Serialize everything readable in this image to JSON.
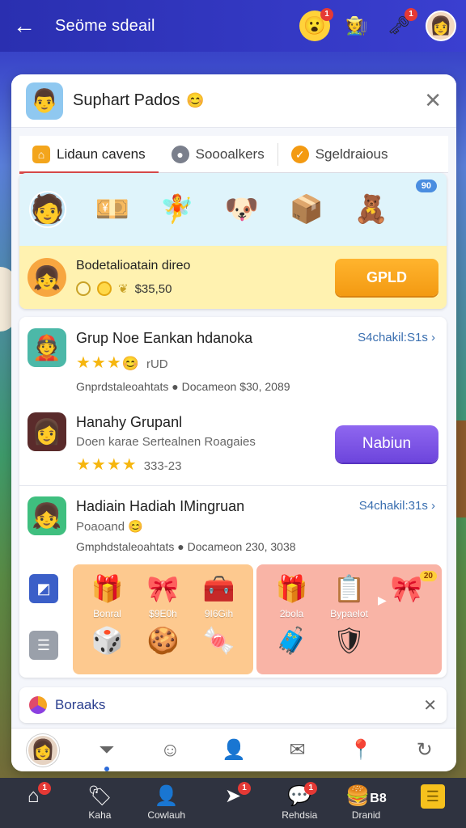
{
  "topbar": {
    "back_icon": "arrow-left-icon",
    "title": "Seöme sdeail",
    "badges": [
      "1",
      "1"
    ]
  },
  "card": {
    "user_name": "Suphart Pados",
    "close_icon": "close-icon"
  },
  "tabs": [
    {
      "label": "Lidaun cavens",
      "icon": "home-icon",
      "color": "#f3a51c"
    },
    {
      "label": "Soooalkers",
      "icon": "location-icon",
      "color": "#7a7f8c"
    },
    {
      "label": "Sgeldraious",
      "icon": "check-icon",
      "color": "#f39a12"
    }
  ],
  "featured": {
    "count_badge": "90",
    "offer_title": "Bodetalioatain direo",
    "offer_value": "$35,50",
    "button": "GPLD"
  },
  "list": {
    "row1": {
      "title": "Grup Noe Eankan hdanoka",
      "stars_extra": "rUD",
      "meta": "Gnprdstaleoahtats ● Docameon $30, 2089",
      "link": "S4chakil:S1s"
    },
    "row2": {
      "title": "Hanahy Grupanl",
      "sub": "Doen karae Sertealnen Roagaies",
      "stars_extra": "333-23",
      "button": "Nabiun"
    },
    "row3": {
      "title": "Hadiain Hadiah IMingruan",
      "sub": "Poaoand",
      "meta": "Gmphdstaleoahtats ● Docameon 230, 3038",
      "link": "S4chakil:31s"
    }
  },
  "rewards": {
    "left": [
      {
        "label": "Bonral",
        "icon": "gift-box-icon"
      },
      {
        "label": "$9E0h",
        "icon": "gift-box-icon"
      },
      {
        "label": "9I6Gih",
        "icon": "treasure-chest-icon"
      },
      {
        "label": "",
        "icon": "dice-icon"
      },
      {
        "label": "",
        "icon": "cookie-icon"
      },
      {
        "label": "",
        "icon": "candy-icon"
      }
    ],
    "right": [
      {
        "label": "2bola",
        "icon": "gift-box-icon"
      },
      {
        "label": "Bypaelot",
        "icon": "clipboard-icon"
      },
      {
        "label": "",
        "icon": "gift-icon"
      },
      {
        "label": "",
        "icon": "chest-icon"
      },
      {
        "label": "",
        "icon": "shield-icon"
      },
      {
        "label": "",
        "icon": ""
      }
    ],
    "right_badge": "20"
  },
  "strip": {
    "label": "Boraaks"
  },
  "bottomnav": [
    {
      "label": "",
      "icon": "home-icon",
      "badge": "1"
    },
    {
      "label": "Kaha",
      "icon": "tag-icon",
      "badge": ""
    },
    {
      "label": "Cowlauh",
      "icon": "person-icon",
      "badge": ""
    },
    {
      "label": "",
      "icon": "send-icon",
      "badge": "1"
    },
    {
      "label": "Rehdsia",
      "icon": "chat-icon",
      "badge": "1"
    },
    {
      "label": "Dranid",
      "icon": "food-icon",
      "badge": ""
    },
    {
      "label": "",
      "icon": "menu-icon",
      "badge": ""
    }
  ],
  "bottomnav_extra": "B8"
}
